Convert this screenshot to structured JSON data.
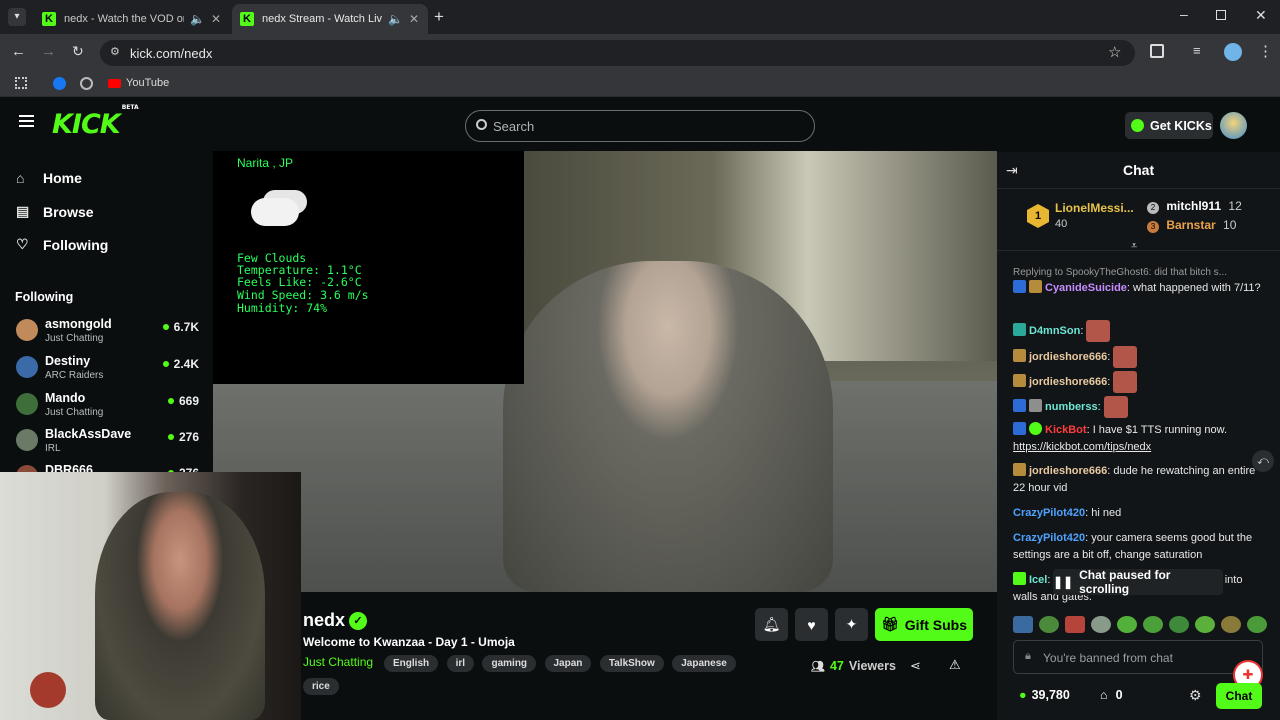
{
  "browser": {
    "tabs": [
      {
        "title": "nedx - Watch the VOD on Kick",
        "active": false
      },
      {
        "title": "nedx Stream - Watch Live on Kick",
        "active": true
      }
    ],
    "url": "kick.com/nedx",
    "bookmarks": [
      {
        "label": "YouTube"
      }
    ]
  },
  "header": {
    "logo": "KICK",
    "logo_badge": "BETA",
    "search_placeholder": "Search",
    "get_kicks": "Get KICKs"
  },
  "sidebar": {
    "nav": [
      {
        "label": "Home",
        "icon": "home-icon"
      },
      {
        "label": "Browse",
        "icon": "browse-icon"
      },
      {
        "label": "Following",
        "icon": "heart-icon"
      }
    ],
    "following_title": "Following",
    "channels": [
      {
        "name": "asmongold",
        "game": "Just Chatting",
        "viewers": "6.7K",
        "color": "#c08a5a"
      },
      {
        "name": "Destiny",
        "game": "ARC Raiders",
        "viewers": "2.4K",
        "color": "#3a6aa8"
      },
      {
        "name": "Mando",
        "game": "Just Chatting",
        "viewers": "669",
        "color": "#3e6e3a"
      },
      {
        "name": "BlackAssDave",
        "game": "IRL",
        "viewers": "276",
        "color": "#6a7a66"
      },
      {
        "name": "DBR666",
        "game": "",
        "viewers": "276",
        "color": "#8a4a3a"
      }
    ]
  },
  "video": {
    "weather_location": "Narita , JP",
    "weather_lines": [
      "Few Clouds",
      "Temperature: 1.1°C",
      "Feels Like: -2.6°C",
      "Wind Speed: 3.6 m/s",
      "Humidity: 74%"
    ]
  },
  "stream": {
    "channel": "nedx",
    "title": "Welcome to Kwanzaa - Day 1 - Umoja",
    "category": "Just Chatting",
    "tags": [
      "English",
      "irl",
      "gaming",
      "Japan",
      "TalkShow",
      "Japanese",
      "rice"
    ],
    "viewers": "47",
    "viewers_label": "Viewers",
    "gift_subs": "Gift Subs"
  },
  "chat": {
    "title": "Chat",
    "top_gifters": [
      {
        "rank": "1",
        "name": "LionelMessi...",
        "count": "40"
      },
      {
        "rank": "2",
        "name": "mitchl911",
        "count": "12"
      },
      {
        "rank": "3",
        "name": "Barnstar",
        "count": "10"
      }
    ],
    "messages": [
      {
        "reply": "Replying to SpookyTheGhost6: did that bitch s..."
      },
      {
        "user": "CyanideSuicide",
        "color": "#c58bff",
        "text": "what happened with 7/11?"
      },
      {
        "user": "D4mnSon",
        "color": "#6ee6d4",
        "text": ""
      },
      {
        "user": "jordieshore666",
        "color": "#e8c9a0",
        "text": ""
      },
      {
        "user": "jordieshore666",
        "color": "#e8c9a0",
        "text": ""
      },
      {
        "user": "numberss",
        "color": "#6ee6d4",
        "text": ""
      },
      {
        "user": "KickBot",
        "color": "#ff3b3b",
        "text": "I have $1 TTS running now.",
        "link": "https://kickbot.com/tips/nedx"
      },
      {
        "user": "jordieshore666",
        "color": "#e8c9a0",
        "text": "dude he rewatching an entire 22 hour vid"
      },
      {
        "user": "CrazyPilot420",
        "color": "#4da3ff",
        "text": "hi ned"
      },
      {
        "user": "CrazyPilot420",
        "color": "#4da3ff",
        "text": "your camera seems good but the settings are a bit off, change saturation"
      },
      {
        "user": "Icel",
        "color": "#6ee6d4",
        "text": "pausing you and pushing you hard into walls and gates."
      }
    ],
    "paused_notice": "Chat paused for scrolling",
    "input_placeholder": "You're banned from chat",
    "points": "39,780",
    "treasure": "0",
    "send_label": "Chat"
  }
}
